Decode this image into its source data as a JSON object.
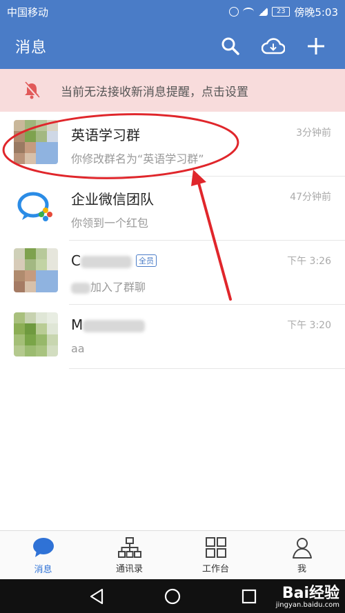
{
  "status_bar": {
    "carrier": "中国移动",
    "battery": "23",
    "time": "傍晚5:03"
  },
  "app_bar": {
    "title": "消息"
  },
  "notice": {
    "text": "当前无法接收新消息提醒，点击设置"
  },
  "conversations": [
    {
      "name": "英语学习群",
      "message": "你修改群名为“英语学习群”",
      "time": "3分钟前"
    },
    {
      "name": "企业微信团队",
      "message": "你领到一个红包",
      "time": "47分钟前"
    },
    {
      "name": "C",
      "badge": "全员",
      "message": "加入了群聊",
      "time": "下午 3:26"
    },
    {
      "name": "M",
      "message": "aa",
      "time": "下午 3:20"
    }
  ],
  "tabs": [
    {
      "label": "消息",
      "icon": "chat-bubble-icon",
      "active": true
    },
    {
      "label": "通讯录",
      "icon": "org-chart-icon"
    },
    {
      "label": "工作台",
      "icon": "grid-icon"
    },
    {
      "label": "我",
      "icon": "person-icon"
    }
  ],
  "watermark": {
    "brand": "Bai经验",
    "url": "jingyan.baidu.com"
  },
  "colors": {
    "primary": "#4a7cc7",
    "notice_bg": "#f8dcdc",
    "annotation_red": "#e0262b",
    "active_tab": "#2f72d6"
  }
}
